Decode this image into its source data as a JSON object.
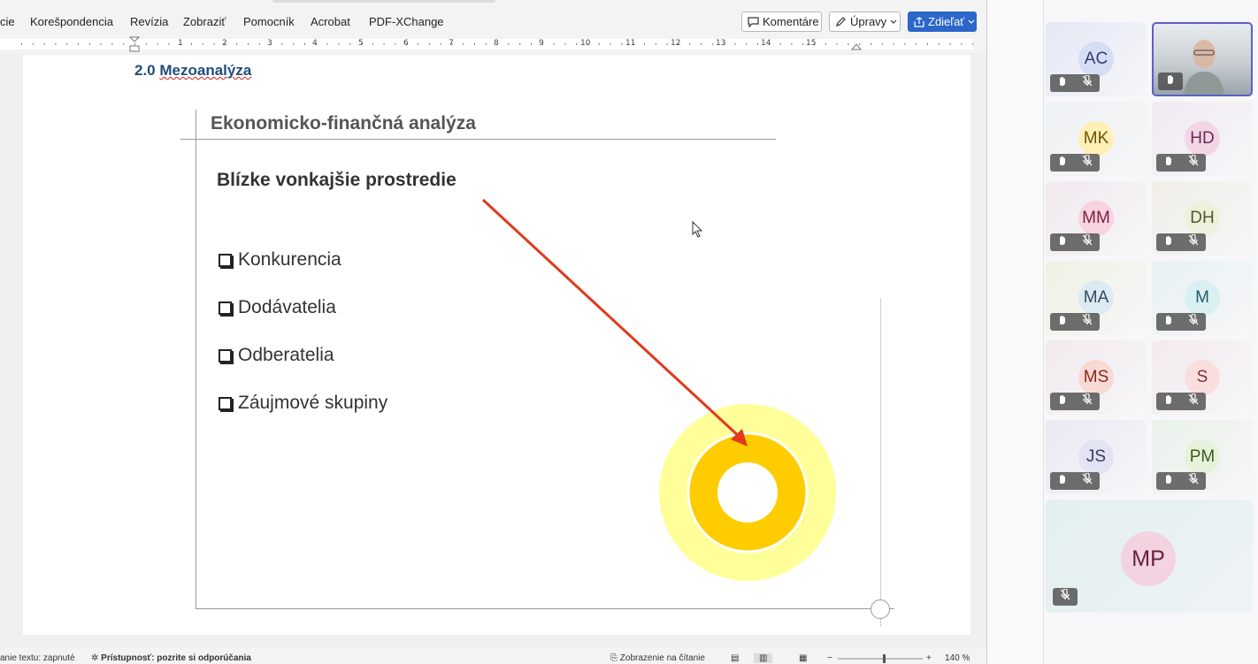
{
  "word": {
    "menu": [
      "cie",
      "Korešpondencia",
      "Revízia",
      "Zobraziť",
      "Pomocník",
      "Acrobat",
      "PDF-XChange"
    ],
    "buttons": {
      "comments": "Komentáre",
      "editing": "Úpravy",
      "share": "Zdieľať"
    },
    "ruler_numbers": [
      "1",
      "2",
      "3",
      "4",
      "5",
      "6",
      "7",
      "8",
      "9",
      "10",
      "11",
      "12",
      "13",
      "14",
      "15"
    ],
    "doc_heading": {
      "number": "2.0",
      "text": "Mezoanalýza"
    },
    "slide": {
      "title": "Ekonomicko-finančná analýza",
      "subtitle": "Blízke vonkajšie prostredie",
      "bullets": [
        "Konkurencia",
        "Dodávatelia",
        "Odberatelia",
        "Záujmové skupiny"
      ],
      "colors": {
        "arrow": "#e03a1c",
        "ring_outer": "#ffff99",
        "ring_inner": "#ffcc00"
      }
    },
    "status": {
      "text_prediction": "anie textu: zapnuté",
      "accessibility": "Prístupnosť: pozrite si odporúčania",
      "reading_view": "Zobrazenie na čítanie",
      "zoom": "140 %"
    }
  },
  "teams": {
    "participants": [
      {
        "initials": "AC",
        "bg": "#e4e8f6",
        "fg": "#2f3b6f",
        "av": "#d6def5",
        "hand": true
      },
      {
        "initials": "",
        "video": true,
        "hand": true
      },
      {
        "initials": "MK",
        "bg": "#eef1f3",
        "fg": "#6b5300",
        "av": "#fff0b8",
        "hand": true
      },
      {
        "initials": "HD",
        "bg": "#f0eaf2",
        "fg": "#6b2a55",
        "av": "#f3d6e6",
        "hand": true
      },
      {
        "initials": "MM",
        "bg": "#f1e9ef",
        "fg": "#7a1f40",
        "av": "#f6d3de",
        "hand": true
      },
      {
        "initials": "DH",
        "bg": "#f1eee7",
        "fg": "#4d5a2a",
        "av": "#eef0dc",
        "hand": true
      },
      {
        "initials": "MA",
        "bg": "#eef2e3",
        "fg": "#2f4d5a",
        "av": "#dcebf1",
        "hand": true
      },
      {
        "initials": "M",
        "bg": "#e8f1f2",
        "fg": "#245a6a",
        "av": "#d9f0f2",
        "hand": true
      },
      {
        "initials": "MS",
        "bg": "#f2e9ee",
        "fg": "#8a2a1a",
        "av": "#f8dad4",
        "hand": true
      },
      {
        "initials": "S",
        "bg": "#f3eaee",
        "fg": "#8a2a3a",
        "av": "#fadede",
        "hand": true
      },
      {
        "initials": "JS",
        "bg": "#ebe8f3",
        "fg": "#3a3a66",
        "av": "#e2e3f3",
        "hand": true
      },
      {
        "initials": "PM",
        "bg": "#eaf1ea",
        "fg": "#3d5a1f",
        "av": "#e6f2da",
        "hand": true
      }
    ],
    "large": {
      "initials": "MP",
      "bg": "#e3efef",
      "fg": "#6a1e40",
      "av": "#f2d3df"
    }
  }
}
